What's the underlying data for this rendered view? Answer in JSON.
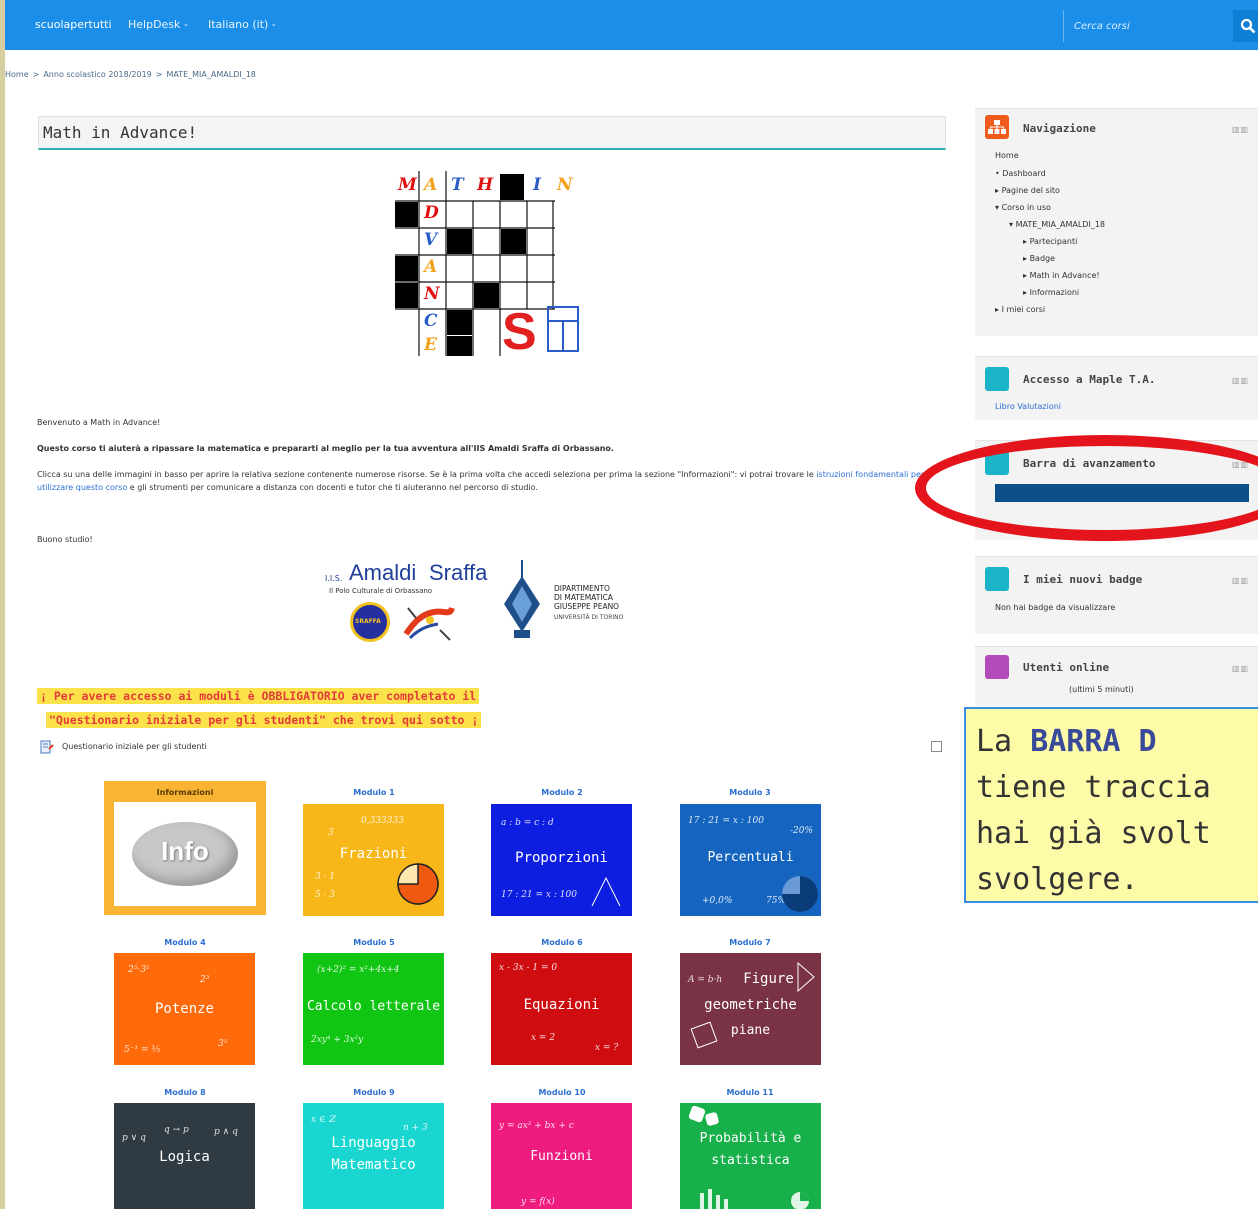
{
  "navbar": {
    "brand": "scuolapertutti",
    "helpdesk": "HelpDesk -",
    "language": "Italiano (it) -",
    "search_placeholder": "Cerca corsi",
    "search_icon": "search-icon"
  },
  "breadcrumb": [
    "Home",
    ">",
    "Anno scolastico 2018/2019",
    ">",
    "MATE_MIA_AMALDI_18"
  ],
  "course": {
    "title": "Math in Advance!",
    "crossword_letters": [
      "M",
      "A",
      "T",
      "H",
      "I",
      "N",
      "D",
      "V",
      "A",
      "N",
      "C",
      "E"
    ]
  },
  "intro": {
    "welcome": "Benvenuto a Math in Advance!",
    "lead": "Questo corso ti aiuterà a ripassare la matematica e prepararti al meglio per la tua avventura all'IIS Amaldi Sraffa di Orbassano.",
    "p1_a": "Clicca su una delle immagini in basso per aprire la relativa sezione contenente numerose risorse. Se è la prima volta che accedi seleziona per prima la sezione",
    "p1_b": "\"Informazioni\": vi potrai trovare le",
    "p1_link": "istruzioni fondamentali per utilizzare questo corso",
    "p1_c": "e gli strumenti per comunicare a distanza con docenti e tutor che ti aiuteranno",
    "p1_d": "nel percorso di studio.",
    "closing": "Buono studio!"
  },
  "logos": {
    "amaldi_prefix": "I.I.S.",
    "amaldi_name1": "Amaldi",
    "amaldi_name2": "Sraffa",
    "amaldi_sub": "Il Polo Culturale di Orbassano",
    "amaldi_badge": "SRAFFA",
    "dip_line1": "DIPARTIMENTO",
    "dip_line2": "DI MATEMATICA",
    "dip_line3": "GIUSEPPE PEANO",
    "dip_line4": "UNIVERSITÀ DI TORINO"
  },
  "warning": {
    "line1": "¡ Per avere accesso ai moduli è OBBLIGATORIO aver completato il",
    "line2": "\"Questionario iniziale per gli studenti\" che trovi qui sotto ¡"
  },
  "quiz_label": "Questionario iniziale per gli studenti",
  "tiles": [
    {
      "label": "Informazioni",
      "title": "Info",
      "color": "#ffffff"
    },
    {
      "label": "Modulo 1",
      "title": "Frazioni",
      "color": "#f7b718"
    },
    {
      "label": "Modulo 2",
      "title": "Proporzioni",
      "color": "#0d1ee0"
    },
    {
      "label": "Modulo 3",
      "title": "Percentuali",
      "color": "#1565c0"
    },
    {
      "label": "Modulo 4",
      "title": "Potenze",
      "color": "#ff6a0a"
    },
    {
      "label": "Modulo 5",
      "title": "Calcolo letterale",
      "color": "#10c612"
    },
    {
      "label": "Modulo 6",
      "title": "Equazioni",
      "color": "#cf0d10"
    },
    {
      "label": "Modulo 7",
      "title_lines": [
        "Figure",
        "geometriche",
        "piane"
      ],
      "color": "#7a3245"
    },
    {
      "label": "Modulo 8",
      "title": "Logica",
      "color": "#2f3a42"
    },
    {
      "label": "Modulo 9",
      "title_lines": [
        "Linguaggio",
        "Matematico"
      ],
      "color": "#19d6d0"
    },
    {
      "label": "Modulo 10",
      "title": "Funzioni",
      "color": "#f01b7e"
    },
    {
      "label": "Modulo 11",
      "title_lines": [
        "Probabilità e",
        "statistica"
      ],
      "color": "#18b04a"
    }
  ],
  "sidebar": {
    "nav": {
      "title": "Navigazione",
      "items": [
        "Home",
        "Dashboard",
        "Pagine del sito",
        "Corso in uso",
        "MATE_MIA_AMALDI_18",
        "Partecipanti",
        "Badge",
        "Math in Advance!",
        "Informazioni",
        "I miei corsi"
      ]
    },
    "maple": {
      "title": "Accesso a Maple T.A.",
      "link": "Libro Valutazioni"
    },
    "progress": {
      "title": "Barra di avanzamento",
      "value": 1.0
    },
    "badges": {
      "title": "I miei nuovi badge",
      "text": "Non hai badge da visualizzare"
    },
    "online": {
      "title": "Utenti online",
      "text": "(ultimi 5 minuti)"
    },
    "block_controls": "▥▥"
  },
  "callout": {
    "line1_a": "La ",
    "line1_b": "BARRA D",
    "line2": "tiene traccia",
    "line3": "hai già svolt",
    "line4": "svolgere."
  }
}
